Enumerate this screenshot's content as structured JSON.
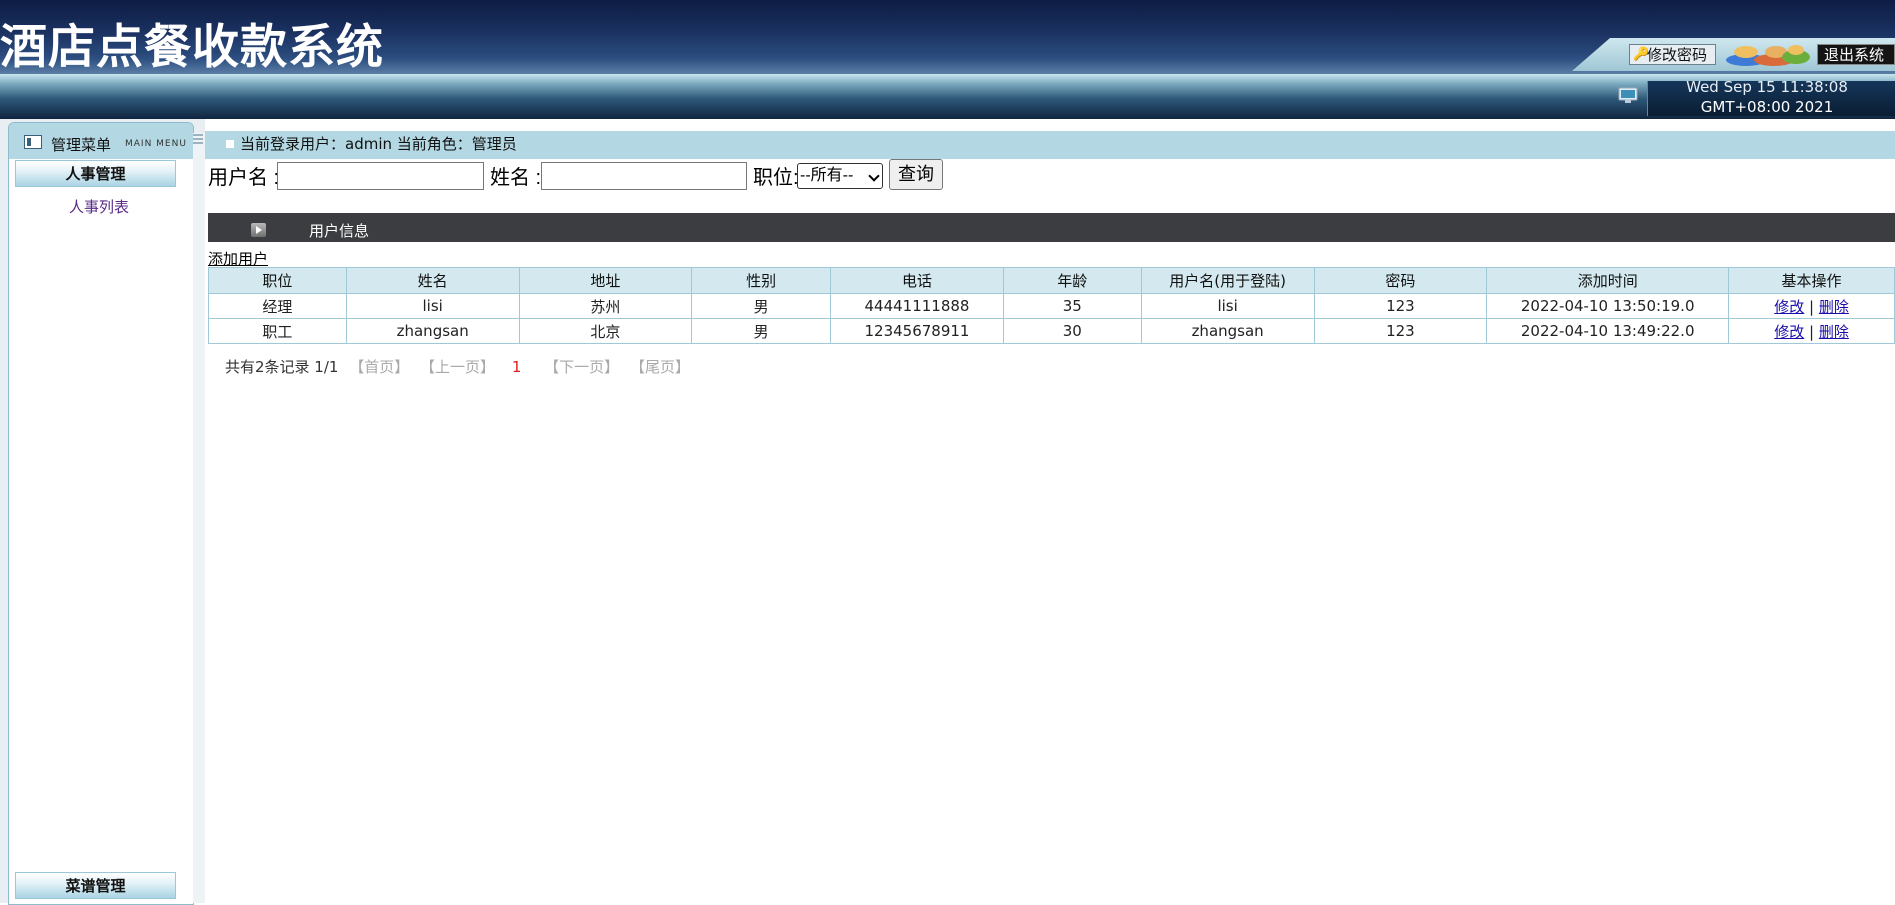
{
  "app": {
    "title": "酒店点餐收款系统"
  },
  "header": {
    "change_password": "修改密码",
    "logout": "退出系统",
    "clock_line1": "Wed Sep 15 11:38:08",
    "clock_line2": "GMT+08:00 2021"
  },
  "sidebar": {
    "title": "管理菜单",
    "subtitle": "MAIN MENU",
    "categories": [
      {
        "label": "人事管理",
        "items": [
          {
            "label": "人事列表"
          }
        ]
      },
      {
        "label": "菜谱管理",
        "items": []
      }
    ]
  },
  "main": {
    "login_info": "当前登录用户：admin   当前角色：管理员",
    "search": {
      "username_label": "用户名 :",
      "name_label": "姓名 :",
      "position_label": "职位:",
      "position_selected": "--所有--",
      "username_value": "",
      "name_value": "",
      "query_button": "查询"
    },
    "section_title": "用户信息",
    "add_user": "添加用户",
    "table": {
      "columns": [
        "职位",
        "姓名",
        "地址",
        "性别",
        "电话",
        "年龄",
        "用户名(用于登陆)",
        "密码",
        "添加时间",
        "基本操作"
      ],
      "rows": [
        [
          "经理",
          "lisi",
          "苏州",
          "男",
          "44441111888",
          "35",
          "lisi",
          "123",
          "2022-04-10 13:50:19.0"
        ],
        [
          "职工",
          "zhangsan",
          "北京",
          "男",
          "12345678911",
          "30",
          "zhangsan",
          "123",
          "2022-04-10 13:49:22.0"
        ]
      ],
      "action_edit": "修改",
      "action_sep": "|",
      "action_delete": "删除"
    },
    "pagination": {
      "summary": "共有2条记录  1/1",
      "first": "【首页】",
      "prev": "【上一页】",
      "current": "1",
      "next": "【下一页】",
      "last": "【尾页】"
    }
  }
}
